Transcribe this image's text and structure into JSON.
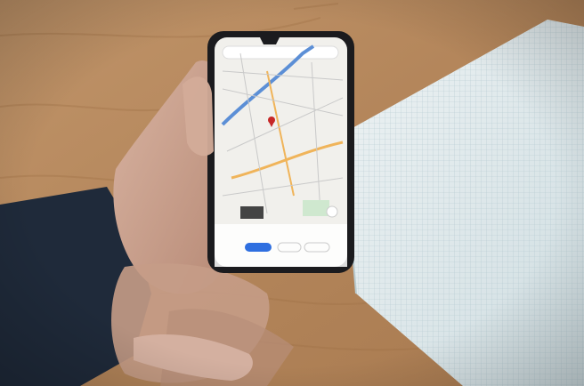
{
  "scene": {
    "kind": "photo",
    "objects": [
      "wooden-table",
      "grid-notebook",
      "hand",
      "smartphone",
      "map-app"
    ]
  },
  "colors": {
    "table": "#b8895a",
    "notebook": "#dfe9ec",
    "sleeve": "#1f2a3a",
    "skin": "#c9a390",
    "phone_body": "#1b1b1e",
    "map_bg": "#f1f0ec",
    "map_road_blue": "#5c8fd6",
    "map_road_orange": "#f0b45a",
    "map_park": "#cfe8cf",
    "map_pin": "#c62828",
    "map_button": "#2f6fe0"
  },
  "phone_screen": {
    "app": "map",
    "elements": [
      "search-bar",
      "location-pin",
      "place-thumbnail",
      "directions-button",
      "action-chips"
    ]
  }
}
